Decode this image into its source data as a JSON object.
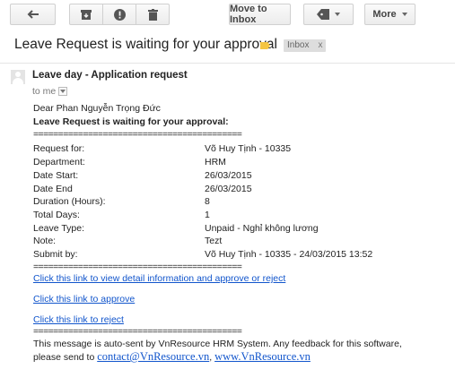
{
  "toolbar": {
    "back_icon": "arrow-left-icon",
    "archive_icon": "archive-icon",
    "spam_icon": "report-spam-icon",
    "delete_icon": "trash-icon",
    "move_to_inbox": "Move to Inbox",
    "labels_icon": "label-tag-icon",
    "more": "More"
  },
  "subject": "Leave Request is waiting for your approval",
  "inbox_label": "Inbox",
  "inbox_label_close": "x",
  "label_color": "#f4c542",
  "sender": "Leave day - Application request",
  "recipient": "to me",
  "body": {
    "greeting": "Dear  Phan Nguyễn Trọng Đức",
    "headline": "Leave Request is waiting for your approval:",
    "separator": "==========================================",
    "fields": [
      {
        "key": "Request for:",
        "value": "Võ Huy Tịnh - 10335"
      },
      {
        "key": "Department:",
        "value": "HRM"
      },
      {
        "key": "Date Start:",
        "value": "26/03/2015"
      },
      {
        "key": "Date End",
        "value": "26/03/2015"
      },
      {
        "key": "Duration (Hours):",
        "value": "8"
      },
      {
        "key": "Total Days:",
        "value": "1"
      },
      {
        "key": "Leave Type:",
        "value": "Unpaid - Nghỉ không lương"
      },
      {
        "key": "Note:",
        "value": "Tezt"
      },
      {
        "key": "Submit by:",
        "value": "Võ Huy Tịnh - 10335 - 24/03/2015 13:52"
      }
    ],
    "link_detail": "Click this link to view detail information and approve or reject",
    "link_approve": "Click this link to approve",
    "link_reject": "Click this link to reject ",
    "footer_line1": "This message is auto-sent by VnResource HRM System. Any feedback for this software,",
    "footer_line2_prefix": "please send to ",
    "footer_email": "contact@VnResource.vn",
    "footer_sep": ", ",
    "footer_site": "www.VnResource.vn"
  },
  "colors": {
    "link": "#1155cc",
    "toolbar_bg": "#f1f1f1"
  }
}
